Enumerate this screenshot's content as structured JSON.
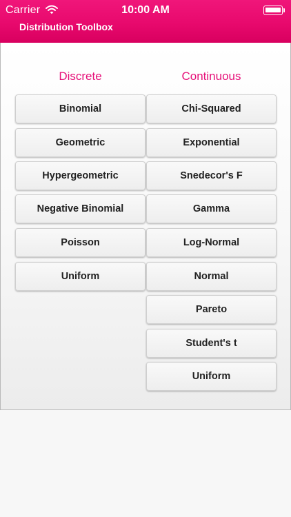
{
  "status_bar": {
    "carrier": "Carrier",
    "time": "10:00 AM",
    "wifi_icon": "wifi-icon",
    "battery_icon": "battery-icon"
  },
  "nav": {
    "title": "Distribution Toolbox"
  },
  "colors": {
    "accent": "#e60f78",
    "header": "#e8096d"
  },
  "discrete": {
    "heading": "Discrete",
    "items": [
      "Binomial",
      "Geometric",
      "Hypergeometric",
      "Negative Binomial",
      "Poisson",
      "Uniform"
    ]
  },
  "continuous": {
    "heading": "Continuous",
    "items": [
      "Chi-Squared",
      "Exponential",
      "Snedecor's F",
      "Gamma",
      "Log-Normal",
      "Normal",
      "Pareto",
      "Student's t",
      "Uniform"
    ]
  }
}
